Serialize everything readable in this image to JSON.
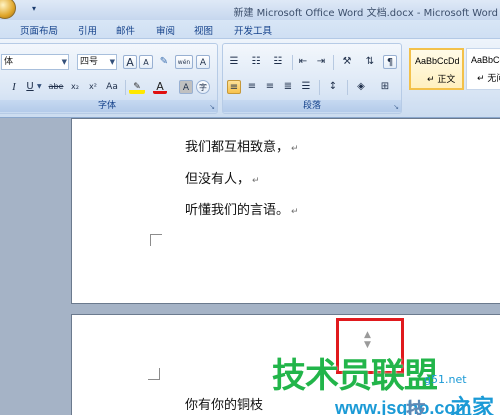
{
  "window": {
    "title": "新建 Microsoft Office Word 文档.docx - Microsoft Word",
    "quick_access_arrow": "▾"
  },
  "menu_tabs": [
    "页面布局",
    "引用",
    "邮件",
    "审阅",
    "视图",
    "开发工具"
  ],
  "ribbon": {
    "font_group": {
      "label": "字体",
      "font_name": "体",
      "font_size": "四号",
      "grow_font": "A",
      "shrink_font": "A",
      "phonetic": "wén",
      "char_border": "A",
      "italic": "I",
      "underline": "U",
      "strike": "abe",
      "subscript": "x₂",
      "superscript": "x²",
      "change_case": "Aa",
      "font_color": "A",
      "char_shading": "A",
      "enclose": "字"
    },
    "paragraph_group": {
      "label": "段落"
    },
    "styles_group": {
      "style1_sample": "AaBbCcDd",
      "style1_name": "↵ 正文",
      "style2_sample": "AaBbCcI",
      "style2_name": "↵ 无间"
    }
  },
  "document": {
    "page1_lines": [
      "我们都互相致意，",
      "但没有人，",
      "听懂我们的言语。"
    ],
    "page2_lines": [
      "你有你的铜枝"
    ],
    "paragraph_mark": "↵",
    "resize_arrows": "▲\n▼"
  },
  "watermark": {
    "main": "技术员联盟",
    "url": "www.jsgho.com",
    "side": "g51.net",
    "jiu": "技",
    "home": "之家"
  },
  "colors": {
    "accent": "#15428b",
    "highlight_box": "#e0191d",
    "watermark_green": "#22b54a",
    "watermark_blue": "#1b9ad6"
  }
}
